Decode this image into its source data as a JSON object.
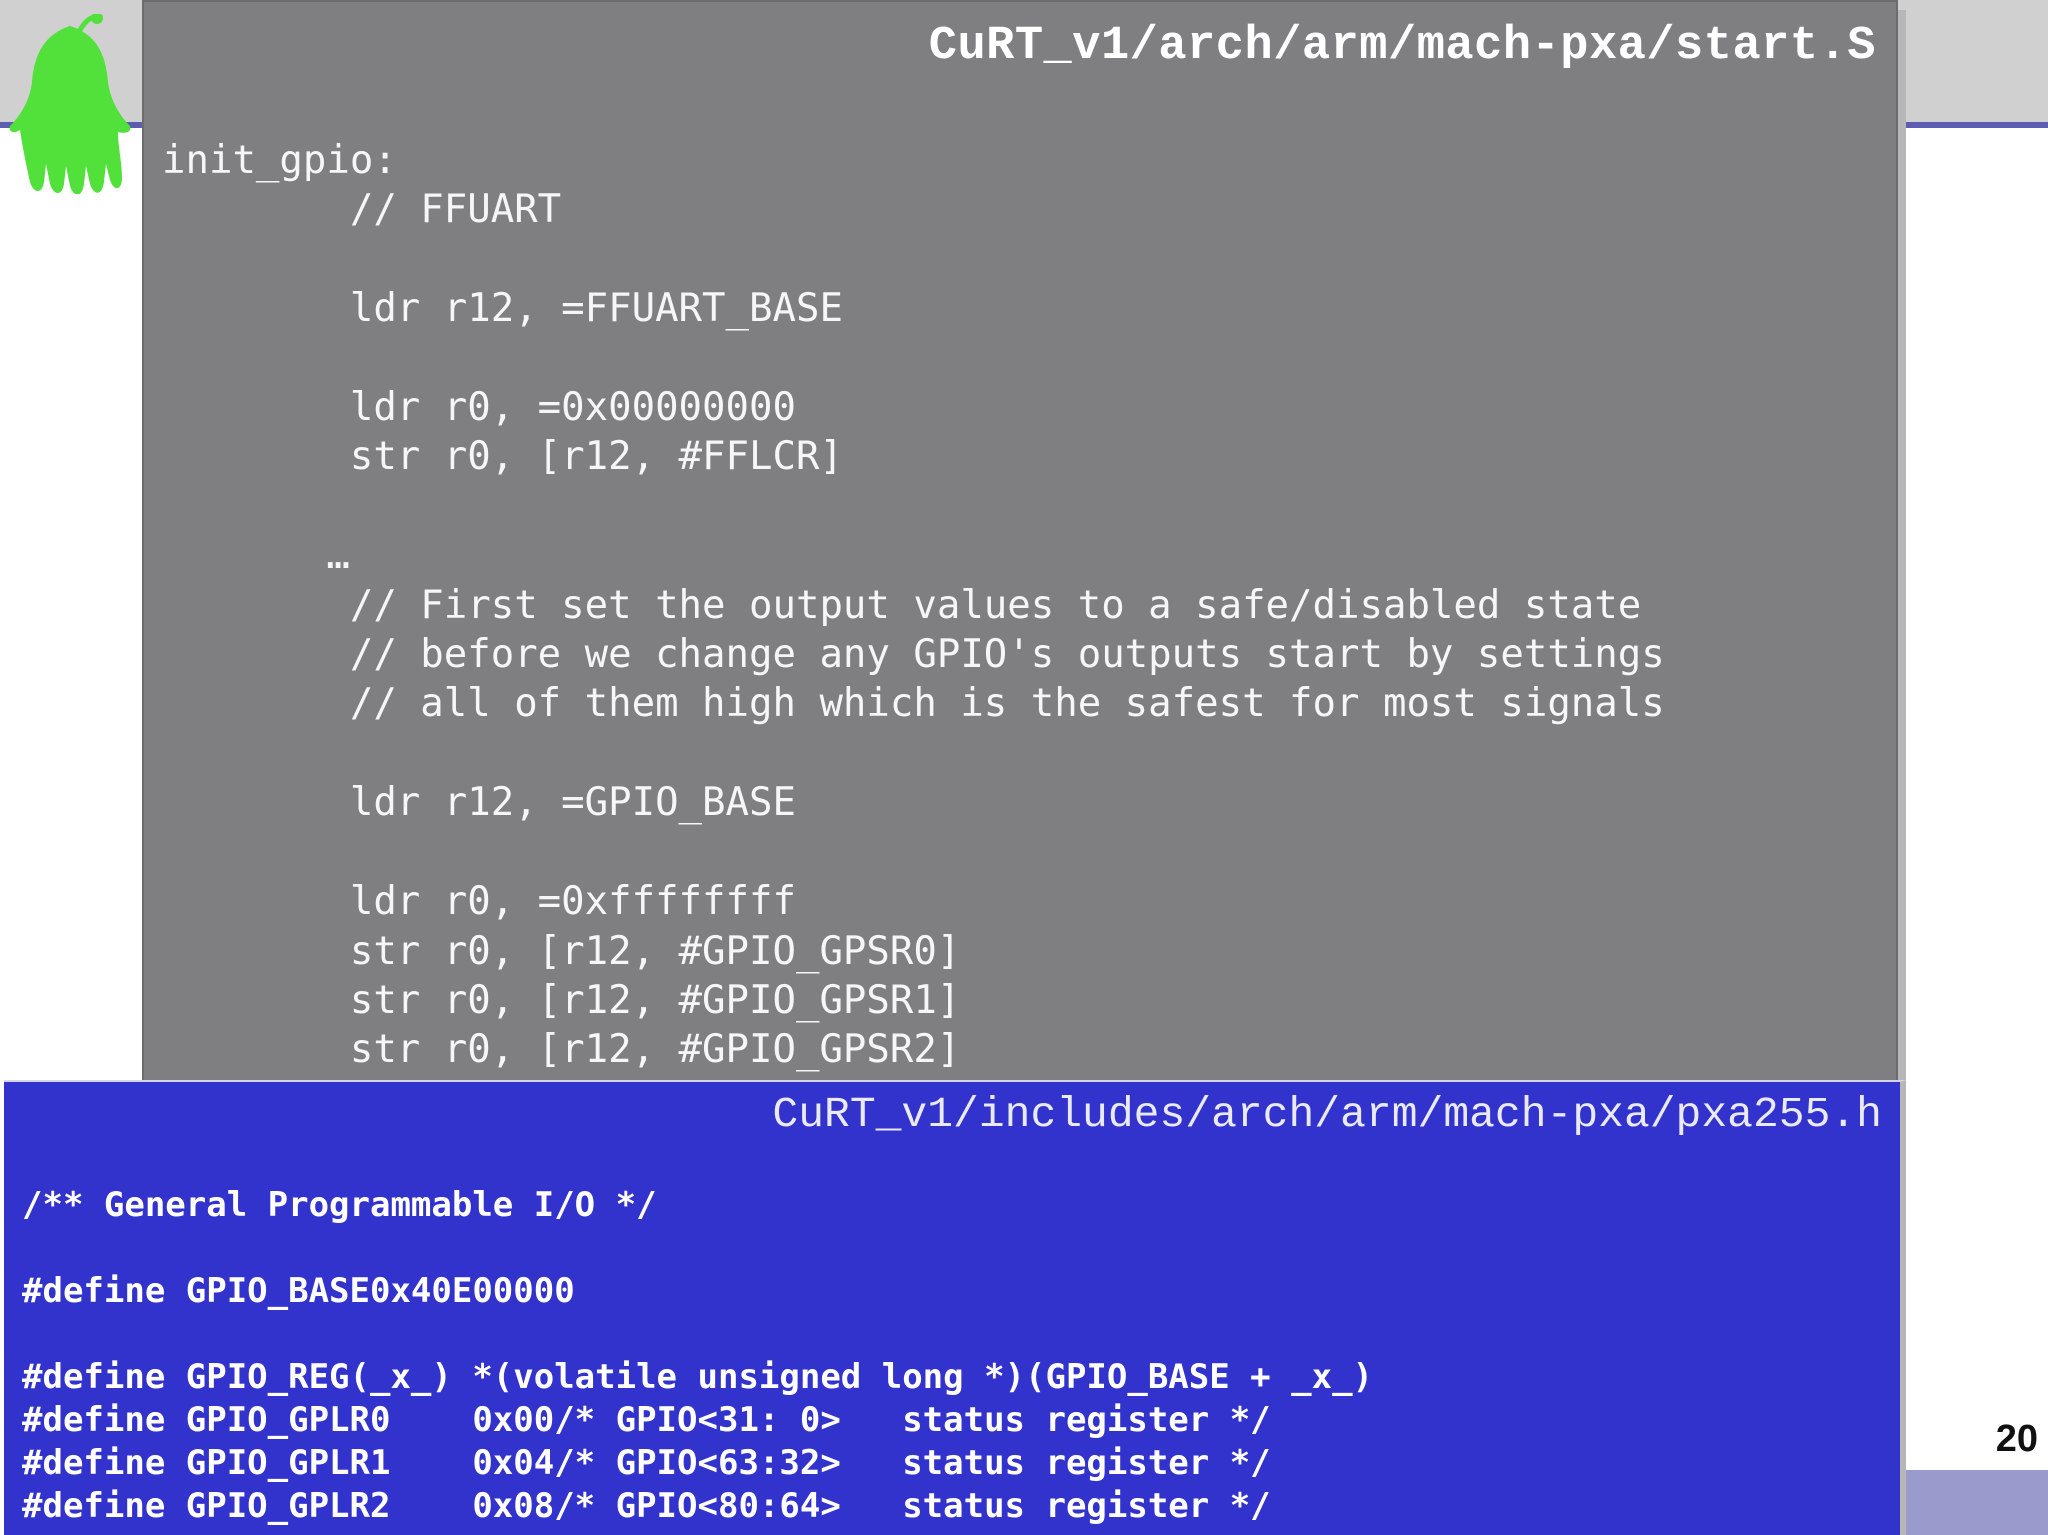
{
  "slide": {
    "page_number": "20"
  },
  "code_panel": {
    "title": "CuRT_v1/arch/arm/mach-pxa/start.S",
    "code": "init_gpio:\n        // FFUART\n\n        ldr r12, =FFUART_BASE\n\n        ldr r0, =0x00000000\n        str r0, [r12, #FFLCR]\n\n       …\n        // First set the output values to a safe/disabled state\n        // before we change any GPIO's outputs start by settings\n        // all of them high which is the safest for most signals\n\n        ldr r12, =GPIO_BASE\n\n        ldr r0, =0xffffffff\n        str r0, [r12, #GPIO_GPSR0]\n        str r0, [r12, #GPIO_GPSR1]\n        str r0, [r12, #GPIO_GPSR2]"
  },
  "header_panel": {
    "title": "CuRT_v1/includes/arch/arm/mach-pxa/pxa255.h",
    "code": "/** General Programmable I/O */\n\n#define GPIO_BASE0x40E00000\n\n#define GPIO_REG(_x_) *(volatile unsigned long *)(GPIO_BASE + _x_)\n#define GPIO_GPLR0    0x00/* GPIO<31: 0>   status register */\n#define GPIO_GPLR1    0x04/* GPIO<63:32>   status register */\n#define GPIO_GPLR2    0x08/* GPIO<80:64>   status register */"
  },
  "colors": {
    "code_panel_bg": "#7f7e81",
    "header_panel_bg": "#3232cc",
    "mascot_green": "#52e03a"
  },
  "icons": {
    "mascot": "green-ghost-mascot-icon"
  }
}
